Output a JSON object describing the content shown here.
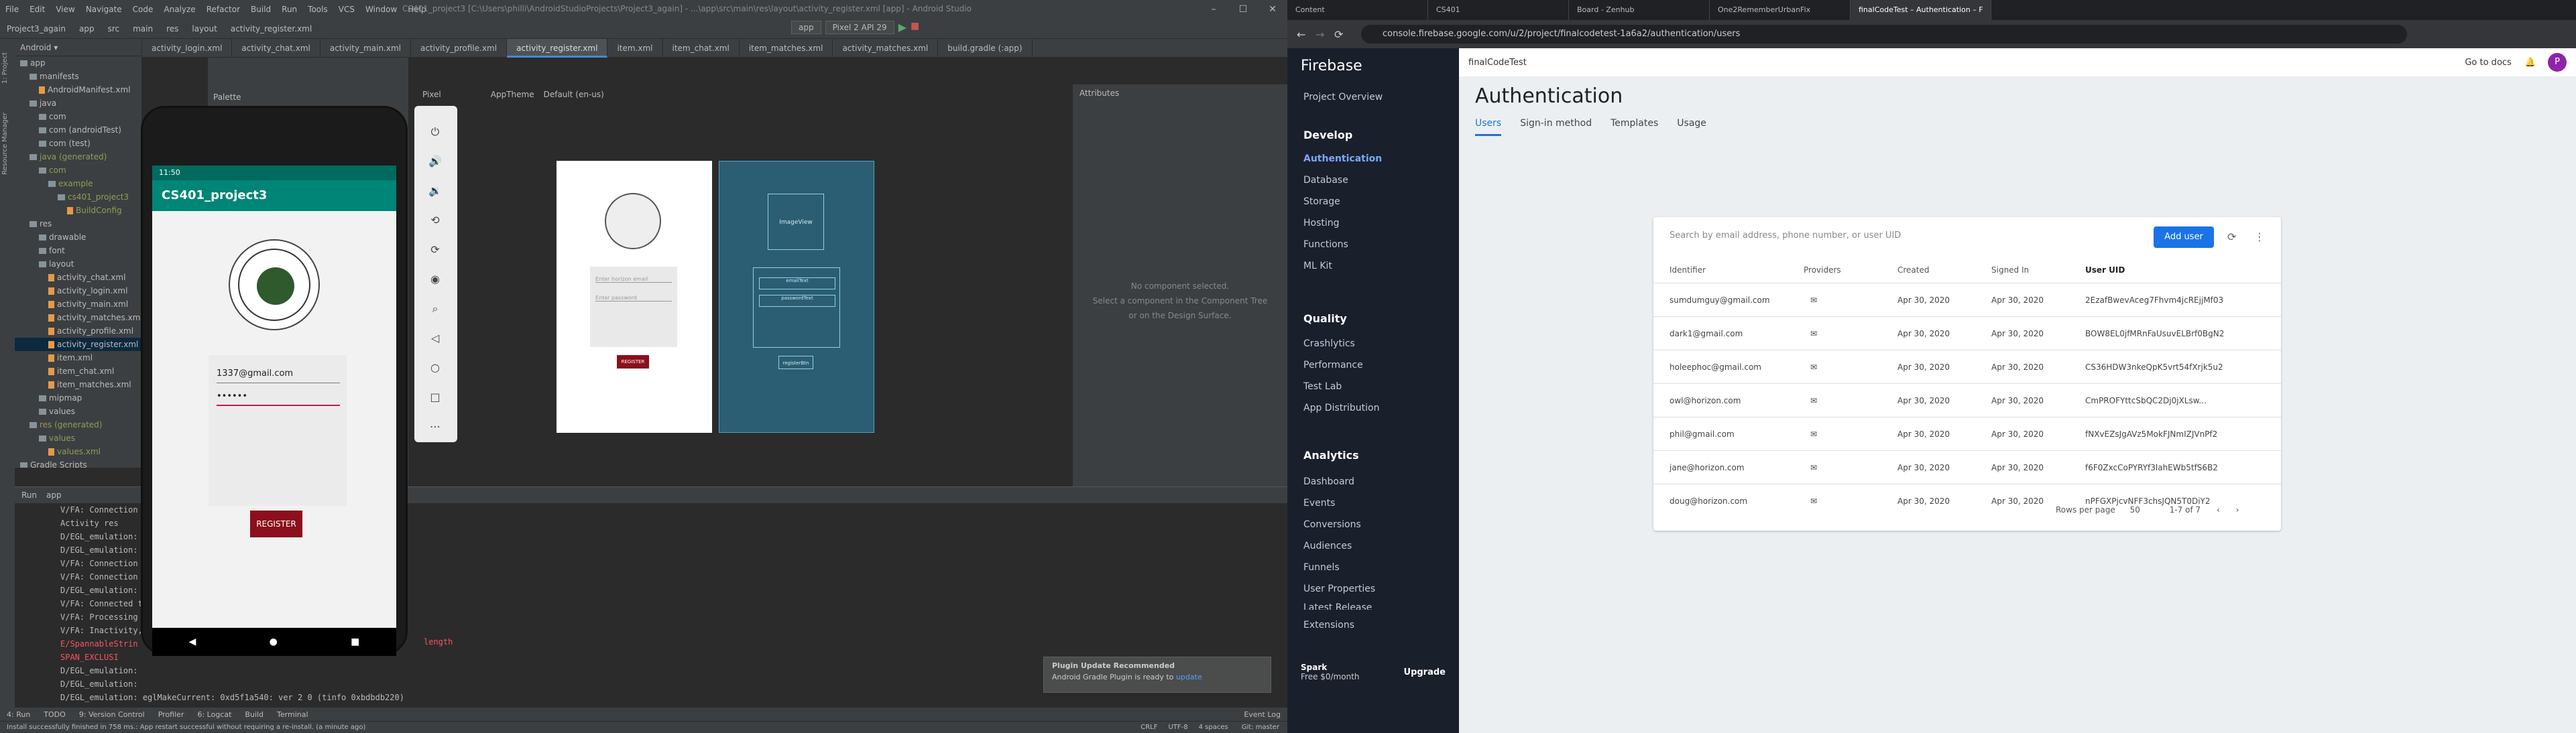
{
  "as": {
    "menu": [
      "File",
      "Edit",
      "View",
      "Navigate",
      "Code",
      "Analyze",
      "Refactor",
      "Build",
      "Run",
      "Tools",
      "VCS",
      "Window",
      "Help"
    ],
    "title": "CS401_project3 [C:\\Users\\philli\\AndroidStudioProjects\\Project3_again] - ...\\app\\src\\main\\res\\layout\\activity_register.xml [app] - Android Studio",
    "breadcrumb": [
      "Project3_again",
      "app",
      "src",
      "main",
      "res",
      "layout",
      "activity_register.xml"
    ],
    "run_config": "app",
    "device": "Pixel 2 API 29",
    "tabs": [
      "activity_login.xml",
      "activity_chat.xml",
      "activity_main.xml",
      "activity_profile.xml",
      "activity_register.xml",
      "item.xml",
      "item_chat.xml",
      "item_matches.xml",
      "activity_matches.xml",
      "build.gradle (:app)"
    ],
    "project_tree": [
      "app",
      "manifests",
      "AndroidManifest.xml",
      "java",
      "com",
      "com (androidTest)",
      "com (test)",
      "java (generated)",
      "com",
      "example",
      "cs401_project3",
      "BuildConfig",
      "res",
      "drawable",
      "font",
      "layout",
      "activity_chat.xml",
      "activity_login.xml",
      "activity_main.xml",
      "activity_matches.xml",
      "activity_profile.xml",
      "activity_register.xml",
      "item.xml",
      "item_chat.xml",
      "item_matches.xml",
      "mipmap",
      "values",
      "res (generated)",
      "values",
      "values.xml",
      "Gradle Scripts"
    ],
    "palette": "Palette",
    "attributes": "Attributes",
    "pixel": "Pixel",
    "theme": "AppTheme",
    "locale": "Default (en-us)",
    "no_component": "No component selected.",
    "select_hint": "Select a component in the Component Tree",
    "select_hint2": "or on the Design Surface.",
    "run_tab": "Run",
    "run_app": "app",
    "log": [
      "V/FA: Connection",
      "Activity res",
      "D/EGL_emulation:",
      "D/EGL_emulation:",
      "V/FA: Connection",
      "V/FA: Connection",
      "D/EGL_emulation:",
      "V/FA: Connected t",
      "V/FA: Processing",
      "V/FA: Inactivity,",
      "E/SpannableStrin",
      "SPAN_EXCLUSI",
      "D/EGL_emulation:",
      "D/EGL_emulation:",
      "D/EGL_emulation: eglMakeCurrent: 0xd5f1a540: ver 2 0 (tinfo 0xbdbdb220)"
    ],
    "log_tail": "length",
    "bottom_tabs": [
      "4: Run",
      "TODO",
      "9: Version Control",
      "Profiler",
      "6: Logcat",
      "Build",
      "Terminal"
    ],
    "event_log": "Event Log",
    "status": "Install successfully finished in 758 ms.: App restart successful without requiring a re-install. (a minute ago)",
    "status_right": [
      "CRLF",
      "UTF-8",
      "4 spaces",
      "Git: master"
    ],
    "notif_title": "Plugin Update Recommended",
    "notif_body": "Android Gradle Plugin is ready to",
    "notif_link": "update",
    "emu": {
      "time": "11:50",
      "app_title": "CS401_project3",
      "email": "1337@gmail.com",
      "password": "••••••",
      "register": "REGISTER"
    },
    "prev1": {
      "email_hint": "Enter horizon email",
      "password_hint": "Enter password",
      "register": "REGISTER"
    },
    "prev2": {
      "image": "ImageView",
      "edit1": "emailText",
      "edit2": "passwordText",
      "button": "registerBtn"
    }
  },
  "br": {
    "tabs": [
      "Content",
      "CS401",
      "Board - Zenhub",
      "One2RememberUrbanFix",
      "finalCodeTest – Authentication – F"
    ],
    "url": "console.firebase.google.com/u/2/project/finalcodetest-1a6a2/authentication/users",
    "fb": {
      "brand": "Firebase",
      "overview": "Project Overview",
      "project": "finalCodeTest",
      "develop": "Develop",
      "develop_items": [
        "Authentication",
        "Database",
        "Storage",
        "Hosting",
        "Functions",
        "ML Kit"
      ],
      "quality": "Quality",
      "quality_items": [
        "Crashlytics",
        "Performance",
        "Test Lab",
        "App Distribution"
      ],
      "analytics": "Analytics",
      "analytics_items": [
        "Dashboard",
        "Events",
        "Conversions",
        "Audiences",
        "Funnels",
        "User Properties",
        "Latest Release"
      ],
      "extensions": "Extensions",
      "spark": "Spark",
      "spark_price": "Free $0/month",
      "upgrade": "Upgrade",
      "goto_docs": "Go to docs",
      "title": "Authentication",
      "tabs": [
        "Users",
        "Sign-in method",
        "Templates",
        "Usage"
      ],
      "search_placeholder": "Search by email address, phone number, or user UID",
      "add_user": "Add user",
      "columns": [
        "Identifier",
        "Providers",
        "Created",
        "Signed In",
        "User UID"
      ],
      "rows": [
        [
          "sumdumguy@gmail.com",
          "Apr 30, 2020",
          "Apr 30, 2020",
          "2EzafBwevAceg7Fhvm4jcREjjMf03"
        ],
        [
          "dark1@gmail.com",
          "Apr 30, 2020",
          "Apr 30, 2020",
          "BOW8EL0jfMRnFaUsuvELBrf0BgN2"
        ],
        [
          "holeephoc@gmail.com",
          "Apr 30, 2020",
          "Apr 30, 2020",
          "CS36HDW3nkeQpK5vrt54fXrjk5u2"
        ],
        [
          "owl@horizon.com",
          "Apr 30, 2020",
          "Apr 30, 2020",
          "CmPROFYttcSbQC2Dj0jXLsw..."
        ],
        [
          "phil@gmail.com",
          "Apr 30, 2020",
          "Apr 30, 2020",
          "fNXvEZsJgAVz5MokFJNmIZJVnPf2"
        ],
        [
          "jane@horizon.com",
          "Apr 30, 2020",
          "Apr 30, 2020",
          "f6F0ZxcCoPYRYf3lahEWb5tfS6B2"
        ],
        [
          "doug@horizon.com",
          "Apr 30, 2020",
          "Apr 30, 2020",
          "nPFGXPjcvNFF3chsJQN5T0DiY2"
        ]
      ],
      "rows_per_page": "Rows per page",
      "rows_per_page_val": "50",
      "pagination": "1-7 of 7"
    }
  }
}
